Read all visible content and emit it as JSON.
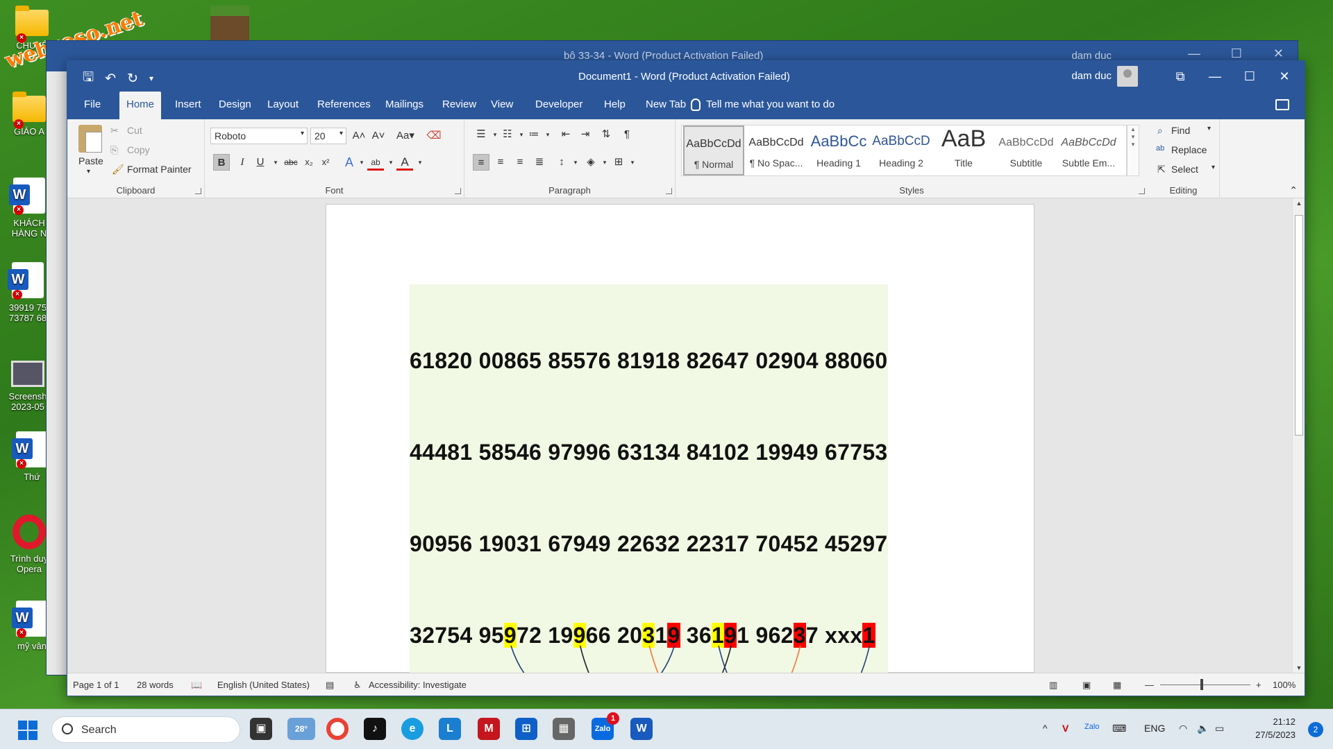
{
  "desktop": {
    "watermark": "webxoso.net",
    "icons": [
      {
        "label": "CHUYÊ",
        "type": "folder"
      },
      {
        "label": "GIÁO A",
        "type": "folder"
      },
      {
        "label": "KHÁCH HÀNG N",
        "type": "word"
      },
      {
        "label": "39919 75 73787 68",
        "type": "word"
      },
      {
        "label": "Screensh 2023-05",
        "type": "screenshot"
      },
      {
        "label": "Thứ",
        "type": "word"
      },
      {
        "label": "Trình duy Opera",
        "type": "opera"
      },
      {
        "label": "mỹ vân",
        "type": "word"
      }
    ]
  },
  "bg_window": {
    "title": "bô 33-34  -  Word (Product Activation Failed)",
    "user": "dam duc"
  },
  "window": {
    "title": "Document1  -  Word (Product Activation Failed)",
    "user": "dam duc"
  },
  "tabs": [
    "File",
    "Home",
    "Insert",
    "Design",
    "Layout",
    "References",
    "Mailings",
    "Review",
    "View",
    "Developer",
    "Help",
    "New Tab"
  ],
  "tell_me": "Tell me what you want to do",
  "clipboard": {
    "label": "Clipboard",
    "paste": "Paste",
    "cut": "Cut",
    "copy": "Copy",
    "format_painter": "Format Painter"
  },
  "font": {
    "label": "Font",
    "family": "Roboto",
    "size": "20"
  },
  "paragraph": {
    "label": "Paragraph"
  },
  "styles": {
    "label": "Styles",
    "items": [
      {
        "preview": "AaBbCcDd",
        "name": "¶ Normal"
      },
      {
        "preview": "AaBbCcDd",
        "name": "¶ No Spac..."
      },
      {
        "preview": "AaBbCc",
        "name": "Heading 1"
      },
      {
        "preview": "AaBbCcD",
        "name": "Heading 2"
      },
      {
        "preview": "AaB",
        "name": "Title"
      },
      {
        "preview": "AaBbCcDd",
        "name": "Subtitle"
      },
      {
        "preview": "AaBbCcDd",
        "name": "Subtle Em..."
      }
    ]
  },
  "editing": {
    "label": "Editing",
    "find": "Find",
    "replace": "Replace",
    "select": "Select"
  },
  "document": {
    "lines": [
      "61820 00865 85576 81918 82647 02904 88060",
      "44481 58546 97996 63134 84102 19949 67753",
      "90956 19031 67949 22632 22317 70452 45297"
    ],
    "last_line": [
      {
        "t": "32754 95"
      },
      {
        "t": "9",
        "hl": "yellow"
      },
      {
        "t": "72 19"
      },
      {
        "t": "9",
        "hl": "yellow"
      },
      {
        "t": "66 20"
      },
      {
        "t": "3",
        "hl": "yellow"
      },
      {
        "t": "1"
      },
      {
        "t": "9",
        "hl": "red"
      },
      {
        "t": " 36"
      },
      {
        "t": "1",
        "hl": "yellow"
      },
      {
        "t": "9",
        "hl": "red"
      },
      {
        "t": "1 962"
      },
      {
        "t": "3",
        "hl": "red"
      },
      {
        "t": "7 xxx"
      },
      {
        "t": "1",
        "hl": "red"
      }
    ],
    "arc_colors": [
      "#1f3e7a",
      "#222222",
      "#ee7d31",
      "#1f3e7a"
    ]
  },
  "status": {
    "page": "Page 1 of 1",
    "words": "28 words",
    "language": "English (United States)",
    "accessibility": "Accessibility: Investigate",
    "zoom": "100%"
  },
  "taskbar": {
    "search": "Search",
    "weather": "28°",
    "zalo_badge": "1",
    "lang": "ENG",
    "time": "21:12",
    "date": "27/5/2023",
    "notifications": "2"
  }
}
